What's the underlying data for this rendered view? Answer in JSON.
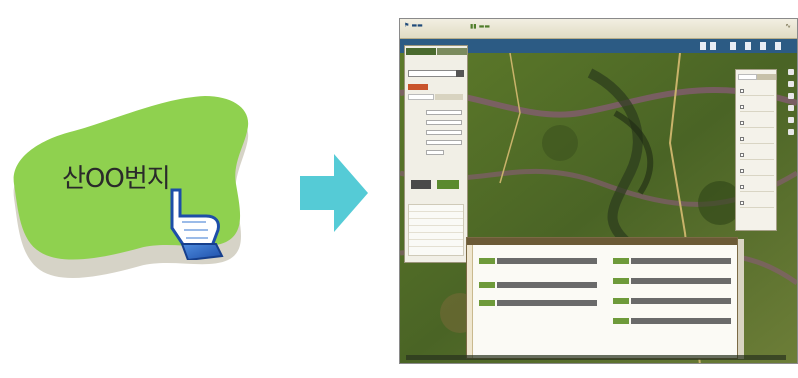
{
  "illustration": {
    "parcel_label": "산OO번지",
    "parcel_color": "#8fd14f",
    "shadow_color": "#d6d3c7",
    "cursor_icon": "pointing-hand-icon",
    "arrow_icon": "right-arrow-icon",
    "arrow_color": "#55cbd6"
  },
  "app": {
    "header_colors": {
      "toolbar": "#2c5b84",
      "dialog_accent": "#6e9a3a",
      "label_accent": "#c9542c"
    }
  }
}
